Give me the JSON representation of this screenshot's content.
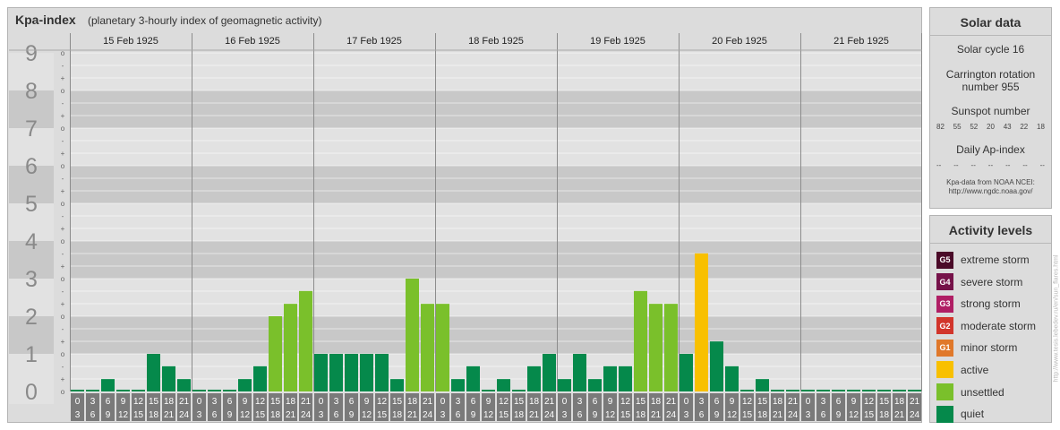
{
  "header": {
    "title": "Kpa-index",
    "subtitle": "(planetary 3-hourly index of geomagnetic activity)"
  },
  "chart_data": {
    "type": "bar",
    "days": [
      "15 Feb 1925",
      "16 Feb 1925",
      "17 Feb 1925",
      "18 Feb 1925",
      "19 Feb 1925",
      "20 Feb 1925",
      "21 Feb 1925"
    ],
    "interval_labels": [
      [
        "0",
        "3"
      ],
      [
        "3",
        "6"
      ],
      [
        "6",
        "9"
      ],
      [
        "9",
        "12"
      ],
      [
        "12",
        "15"
      ],
      [
        "15",
        "18"
      ],
      [
        "18",
        "21"
      ],
      [
        "21",
        "24"
      ]
    ],
    "y_ticks": [
      "0",
      "1",
      "2",
      "3",
      "4",
      "5",
      "6",
      "7",
      "8",
      "9"
    ],
    "minor_marks": [
      "-",
      "o",
      "+"
    ],
    "ylim": [
      0,
      9
    ],
    "values": [
      [
        0,
        0,
        0.33,
        0,
        0,
        1,
        0.67,
        0.33
      ],
      [
        0,
        0,
        0,
        0.33,
        0.67,
        2,
        2.33,
        2.67
      ],
      [
        1,
        1,
        1,
        1,
        1,
        0.33,
        3,
        2.33
      ],
      [
        2.33,
        0.33,
        0.67,
        0,
        0.33,
        0,
        0.67,
        1
      ],
      [
        0.33,
        1,
        0.33,
        0.67,
        0.67,
        2.67,
        2.33,
        2.33
      ],
      [
        1,
        3.67,
        1.33,
        0.67,
        0,
        0.33,
        0,
        0
      ],
      [
        0,
        0,
        0,
        0,
        0,
        0,
        0,
        0
      ]
    ],
    "colors": {
      "quiet": "#05894b",
      "unsettled": "#7ac02b",
      "active": "#f8c000",
      "minor": "#e0782a",
      "moderate": "#d2352b",
      "strong": "#b01e64",
      "severe": "#751249",
      "extreme": "#4a0a28"
    }
  },
  "solar": {
    "title": "Solar data",
    "cycle": "Solar cycle 16",
    "carrington_line1": "Carrington rotation",
    "carrington_line2": "number 955",
    "sunspot_label": "Sunspot number",
    "sunspots": [
      "82",
      "55",
      "52",
      "20",
      "43",
      "22",
      "18"
    ],
    "ap_label": "Daily Ap-index",
    "ap_values": [
      "--",
      "--",
      "--",
      "--",
      "--",
      "--",
      "--"
    ],
    "source_line1": "Kpa-data from NOAA NCEI:",
    "source_line2": "http://www.ngdc.noaa.gov/"
  },
  "activity": {
    "title": "Activity levels",
    "items": [
      {
        "badge": "G5",
        "label": "extreme storm",
        "color": "#4a0a28"
      },
      {
        "badge": "G4",
        "label": "severe storm",
        "color": "#751249"
      },
      {
        "badge": "G3",
        "label": "strong storm",
        "color": "#b01e64"
      },
      {
        "badge": "G2",
        "label": "moderate storm",
        "color": "#d2352b"
      },
      {
        "badge": "G1",
        "label": "minor storm",
        "color": "#e0782a"
      },
      {
        "badge": "",
        "label": "active",
        "color": "#f8c000"
      },
      {
        "badge": "",
        "label": "unsettled",
        "color": "#7ac02b"
      },
      {
        "badge": "",
        "label": "quiet",
        "color": "#05894b"
      }
    ]
  },
  "credit": "http://www.tesis.lebedev.ru/en/sun_flares.html"
}
